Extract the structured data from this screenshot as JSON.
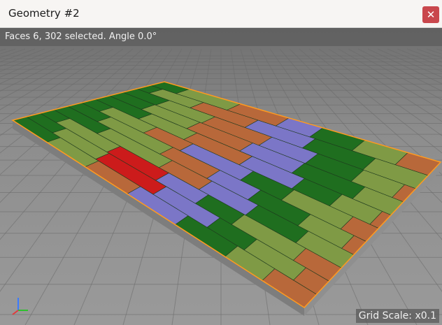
{
  "window": {
    "title": "Geometry #2",
    "close_label": "✕"
  },
  "status": {
    "text": "Faces 6, 302 selected. Angle 0.0°"
  },
  "footer": {
    "grid_scale": "Grid Scale: x0.1"
  },
  "colors": {
    "green": "#1f6e1f",
    "light_green": "#7f9a45",
    "orange_brown": "#b8683a",
    "purple": "#7b76c7",
    "red": "#cc1b1b",
    "edge_highlight": "#ff9a1f",
    "floor": "#8b8b8b",
    "grid_line": "#6a6a6a"
  },
  "icons": {
    "close": "close-icon",
    "axis_gizmo": "axis-gizmo-icon"
  }
}
